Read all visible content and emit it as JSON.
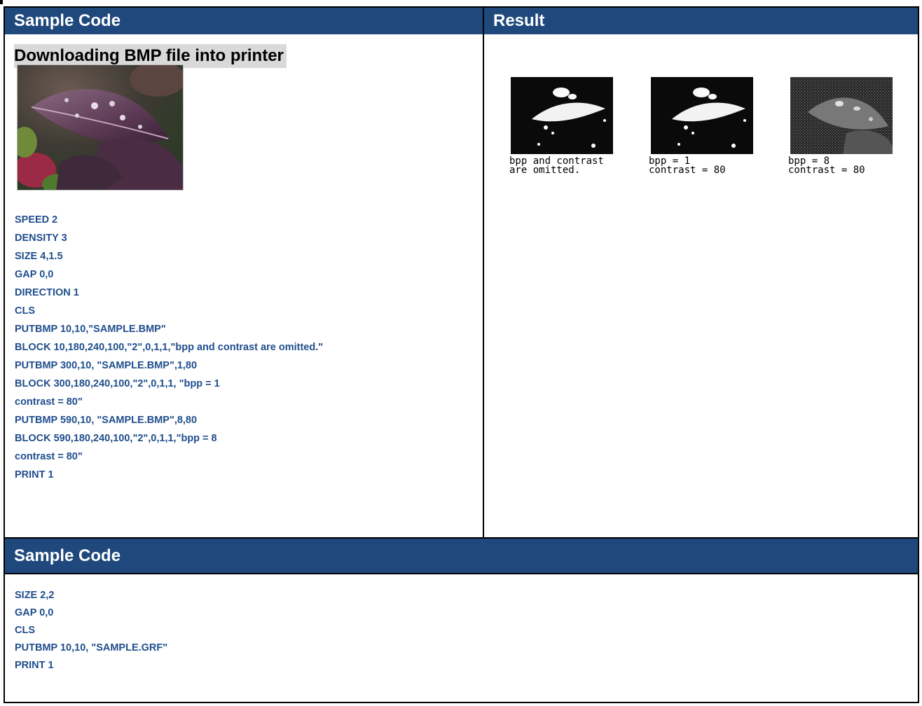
{
  "table1": {
    "col1_header": "Sample Code",
    "col2_header": "Result",
    "subtitle": "Downloading BMP file into printer",
    "code_lines": [
      "SPEED 2",
      "DENSITY 3",
      "SIZE 4,1.5",
      "GAP 0,0",
      "DIRECTION 1",
      "CLS",
      "PUTBMP 10,10,\"SAMPLE.BMP\"",
      "BLOCK 10,180,240,100,\"2\",0,1,1,\"bpp and contrast are omitted.\"",
      "PUTBMP 300,10, \"SAMPLE.BMP\",1,80",
      "BLOCK 300,180,240,100,\"2\",0,1,1, \"bpp = 1",
      "contrast = 80\"",
      "PUTBMP 590,10, \"SAMPLE.BMP\",8,80",
      "BLOCK 590,180,240,100,\"2\",0,1,1,\"bpp = 8",
      "contrast = 80\"",
      "PRINT 1"
    ],
    "results": [
      {
        "caption_line1": "bpp and contrast",
        "caption_line2": "are omitted."
      },
      {
        "caption_line1": "bpp = 1",
        "caption_line2": "contrast = 80"
      },
      {
        "caption_line1": "bpp = 8",
        "caption_line2": "contrast = 80"
      }
    ]
  },
  "table2": {
    "header": "Sample Code",
    "code_lines": [
      "SIZE 2,2",
      "GAP 0,0",
      "CLS",
      "PUTBMP 10,10, \"SAMPLE.GRF\"",
      "PRINT 1"
    ]
  },
  "colors": {
    "header_bg": "#1f497d",
    "code_text": "#1f4e8c",
    "subtitle_bg": "#d9d9d9"
  }
}
